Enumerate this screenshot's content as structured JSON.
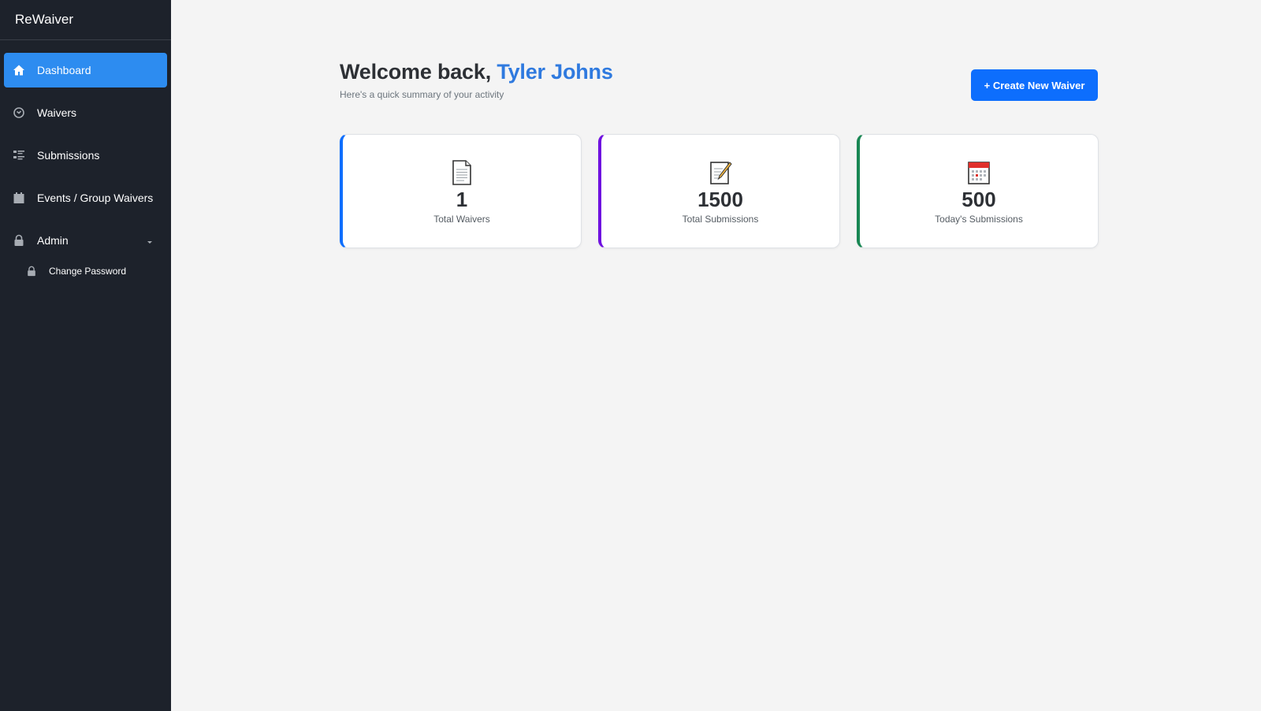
{
  "sidebar": {
    "brand": "ReWaiver",
    "items": [
      {
        "label": "Dashboard",
        "icon": "home-icon"
      },
      {
        "label": "Waivers",
        "icon": "clock-icon"
      },
      {
        "label": "Submissions",
        "icon": "list-icon"
      },
      {
        "label": "Events / Group Waivers",
        "icon": "calendar-icon"
      },
      {
        "label": "Admin",
        "icon": "lock-icon"
      }
    ],
    "subitems": [
      {
        "label": "Change Password",
        "icon": "lock-icon"
      }
    ]
  },
  "header": {
    "greeting": "Welcome back,",
    "user_name": "Tyler Johns",
    "subtitle": "Here's a quick summary of your activity",
    "create_button": "+ Create New Waiver"
  },
  "stats": [
    {
      "value": "1",
      "label": "Total Waivers",
      "icon": "document-icon",
      "accent": "#0d6efd"
    },
    {
      "value": "1500",
      "label": "Total Submissions",
      "icon": "memo-icon",
      "accent": "#6f10e0"
    },
    {
      "value": "500",
      "label": "Today's Submissions",
      "icon": "calendar-icon",
      "accent": "#198754"
    }
  ],
  "colors": {
    "sidebar_bg": "#1d222b",
    "active_item": "#2d8cf0",
    "primary_button": "#0d6efd",
    "user_name": "#2f7adf"
  }
}
